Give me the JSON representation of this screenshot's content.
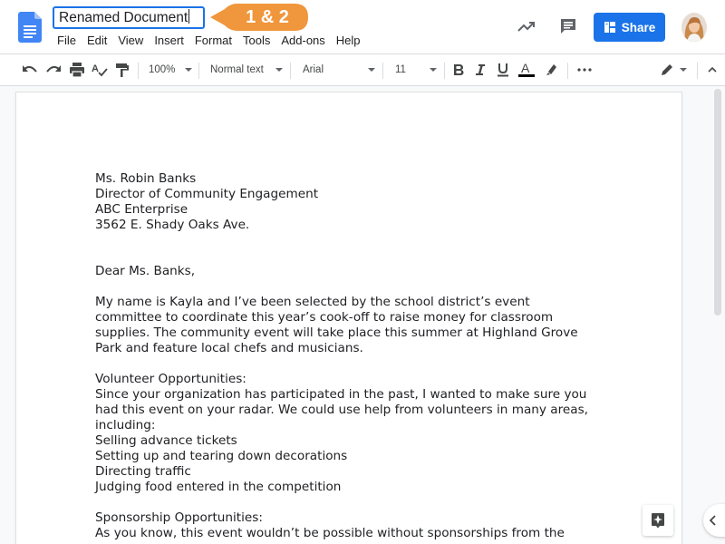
{
  "header": {
    "document_title": "Renamed Document",
    "callout_label": "1 & 2",
    "share_label": "Share"
  },
  "menu": [
    "File",
    "Edit",
    "View",
    "Insert",
    "Format",
    "Tools",
    "Add-ons",
    "Help"
  ],
  "toolbar": {
    "zoom": "100%",
    "style": "Normal text",
    "font": "Arial",
    "font_size": "11"
  },
  "colors": {
    "accent": "#1a73e8",
    "callout": "#f0963c",
    "text_color_underline": "#000000"
  },
  "icons": [
    "docs-logo-icon",
    "undo-icon",
    "redo-icon",
    "print-icon",
    "spellcheck-icon",
    "paint-format-icon",
    "bold-icon",
    "italic-icon",
    "underline-icon",
    "text-color-icon",
    "highlight-icon",
    "more-icon",
    "editing-mode-icon",
    "trend-icon",
    "comment-icon",
    "explore-icon",
    "chevron-left-icon"
  ],
  "document": {
    "lines": [
      "Ms. Robin Banks",
      "Director of Community Engagement",
      "ABC Enterprise",
      "3562 E. Shady Oaks Ave.",
      "",
      "",
      "Dear Ms. Banks,",
      "",
      "My name is Kayla and I’ve been selected by the school district’s event",
      "committee to coordinate this year’s cook-off to raise money for classroom",
      "supplies. The community event will take place this summer at Highland Grove",
      "Park and feature local chefs and musicians.",
      "",
      "Volunteer Opportunities:",
      "Since your organization has participated in the past, I wanted to make sure you",
      "had this event on your radar. We could use help from volunteers in many areas,",
      "including:",
      "Selling advance tickets",
      "Setting up and tearing down decorations",
      "Directing traffic",
      "Judging food entered in the competition",
      "",
      "Sponsorship Opportunities:",
      "As you know, this event wouldn’t be possible without sponsorships from the"
    ]
  }
}
